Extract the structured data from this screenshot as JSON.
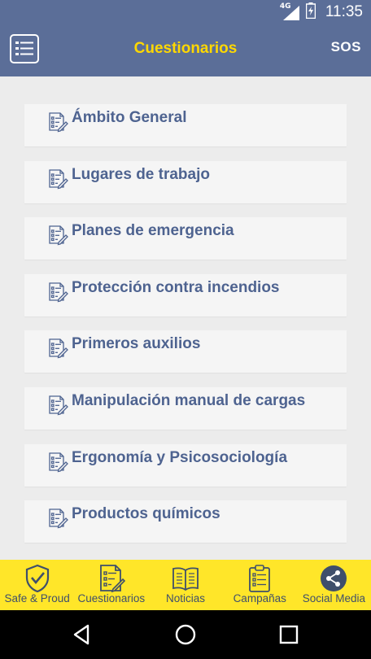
{
  "status_bar": {
    "network": "4G",
    "time": "11:35"
  },
  "app_bar": {
    "title": "Cuestionarios",
    "sos_label": "SOS"
  },
  "questionnaires": [
    {
      "label": "Ámbito General"
    },
    {
      "label": "Lugares de trabajo"
    },
    {
      "label": "Planes de emergencia"
    },
    {
      "label": "Protección contra incendios"
    },
    {
      "label": "Primeros auxilios"
    },
    {
      "label": "Manipulación manual de cargas"
    },
    {
      "label": "Ergonomía y Psicosociología"
    },
    {
      "label": "Productos químicos"
    }
  ],
  "tabs": [
    {
      "label": "Safe & Proud",
      "icon": "shield-check-icon"
    },
    {
      "label": "Cuestionarios",
      "icon": "checklist-icon"
    },
    {
      "label": "Noticias",
      "icon": "open-book-icon"
    },
    {
      "label": "Campañas",
      "icon": "clipboard-icon"
    },
    {
      "label": "Social Media",
      "icon": "share-icon"
    }
  ],
  "colors": {
    "header": "#5b6e98",
    "title": "#ffd800",
    "item_text": "#4e6390",
    "tab_bar": "#ffe629",
    "tab_text": "#3f4f6b"
  }
}
